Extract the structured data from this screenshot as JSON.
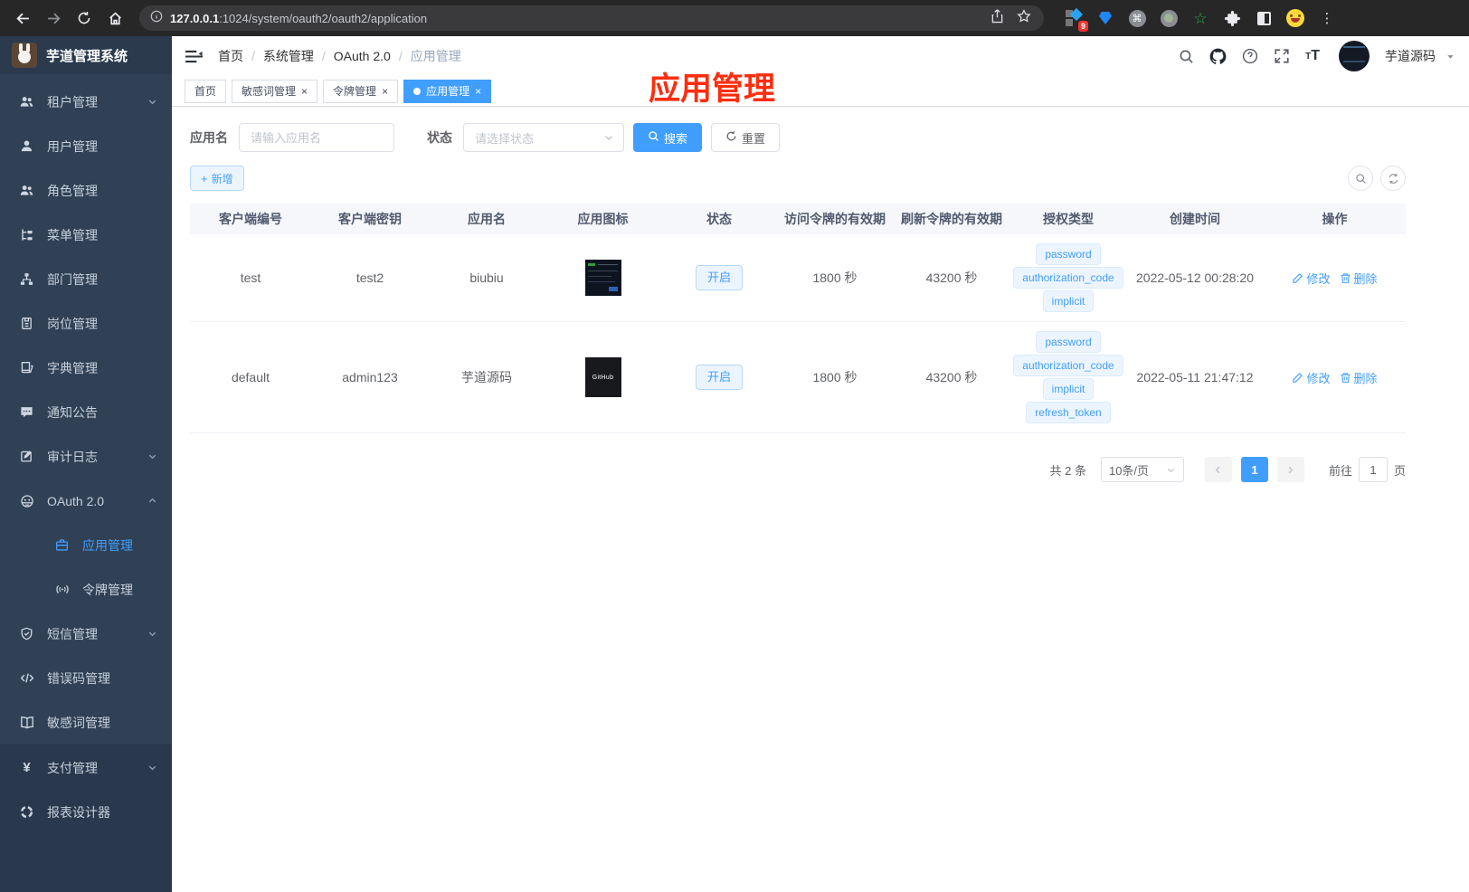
{
  "browser": {
    "url_host": "127.0.0.1",
    "url_rest": ":1024/system/oauth2/oauth2/application",
    "extension_badge": "9"
  },
  "sidebar": {
    "title": "芋道管理系统",
    "items": [
      {
        "id": "tenant",
        "label": "租户管理",
        "icon": "people",
        "arrow": "down"
      },
      {
        "id": "user",
        "label": "用户管理",
        "icon": "user"
      },
      {
        "id": "role",
        "label": "角色管理",
        "icon": "people"
      },
      {
        "id": "menu",
        "label": "菜单管理",
        "icon": "tree"
      },
      {
        "id": "dept",
        "label": "部门管理",
        "icon": "org"
      },
      {
        "id": "post",
        "label": "岗位管理",
        "icon": "badge"
      },
      {
        "id": "dict",
        "label": "字典管理",
        "icon": "dict"
      },
      {
        "id": "notice",
        "label": "通知公告",
        "icon": "message"
      },
      {
        "id": "audit",
        "label": "审计日志",
        "icon": "log",
        "arrow": "down"
      },
      {
        "id": "oauth",
        "label": "OAuth 2.0",
        "icon": "robot",
        "arrow": "up",
        "children": [
          {
            "id": "oauth-app",
            "label": "应用管理",
            "icon": "briefcase",
            "active": true
          },
          {
            "id": "oauth-token",
            "label": "令牌管理",
            "icon": "token"
          }
        ]
      },
      {
        "id": "sms",
        "label": "短信管理",
        "icon": "shield",
        "arrow": "down"
      },
      {
        "id": "errcode",
        "label": "错误码管理",
        "icon": "code"
      },
      {
        "id": "sensitive",
        "label": "敏感词管理",
        "icon": "openbook"
      },
      {
        "id": "pay",
        "label": "支付管理",
        "icon": "yen",
        "arrow": "down",
        "section": true
      },
      {
        "id": "report",
        "label": "报表设计器",
        "icon": "report",
        "section": true
      }
    ]
  },
  "header": {
    "breadcrumb": [
      "首页",
      "系统管理",
      "OAuth 2.0",
      "应用管理"
    ],
    "username": "芋道源码"
  },
  "tabs": [
    {
      "label": "首页",
      "closable": false,
      "active": false
    },
    {
      "label": "敏感词管理",
      "closable": true,
      "active": false
    },
    {
      "label": "令牌管理",
      "closable": true,
      "active": false
    },
    {
      "label": "应用管理",
      "closable": true,
      "active": true
    }
  ],
  "annotation": "应用管理",
  "filters": {
    "name_label": "应用名",
    "name_placeholder": "请输入应用名",
    "status_label": "状态",
    "status_placeholder": "请选择状态",
    "search_label": "搜索",
    "reset_label": "重置",
    "add_label": "新增"
  },
  "table": {
    "columns": [
      "客户端编号",
      "客户端密钥",
      "应用名",
      "应用图标",
      "状态",
      "访问令牌的有效期",
      "刷新令牌的有效期",
      "授权类型",
      "创建时间",
      "操作"
    ],
    "edit_label": "修改",
    "delete_label": "删除",
    "rows": [
      {
        "client_id": "test",
        "secret": "test2",
        "name": "biubiu",
        "icon_type": "screenshot",
        "icon_label": "",
        "status": "开启",
        "access": "1800 秒",
        "refresh": "43200 秒",
        "grants": [
          "password",
          "authorization_code",
          "implicit"
        ],
        "created": "2022-05-12 00:28:20"
      },
      {
        "client_id": "default",
        "secret": "admin123",
        "name": "芋道源码",
        "icon_type": "github",
        "icon_label": "GitHub",
        "status": "开启",
        "access": "1800 秒",
        "refresh": "43200 秒",
        "grants": [
          "password",
          "authorization_code",
          "implicit",
          "refresh_token"
        ],
        "created": "2022-05-11 21:47:12"
      }
    ]
  },
  "pagination": {
    "total": "共 2 条",
    "page_size": "10条/页",
    "current_page": "1",
    "goto_label": "前往",
    "goto_value": "1",
    "page_suffix": "页"
  }
}
